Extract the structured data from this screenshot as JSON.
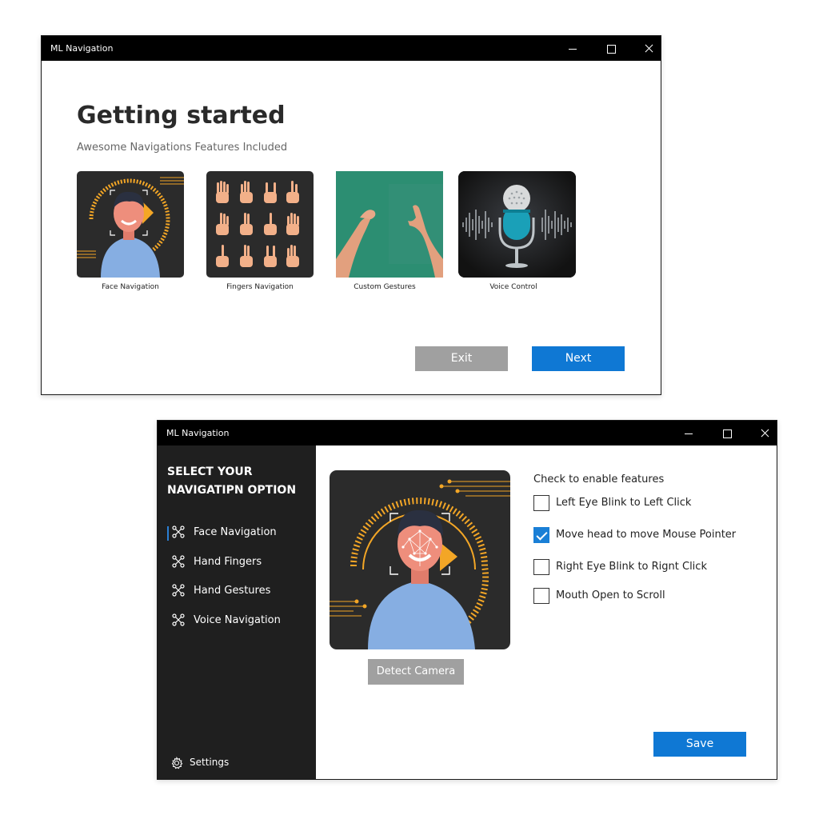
{
  "colors": {
    "accent": "#0f78d4",
    "disabled": "#a0a0a0",
    "sidebar": "#1f1f1f",
    "titlebar": "#000000",
    "illustration_bg": "#2b2b2b",
    "orange": "#f3a626"
  },
  "window1": {
    "title": "ML Navigation",
    "heading": "Getting started",
    "subheading": "Awesome Navigations Features Included",
    "cards": [
      {
        "label": "Face Navigation",
        "icon": "face-scan-illustration"
      },
      {
        "label": "Fingers Navigation",
        "icon": "hand-gestures-grid-illustration"
      },
      {
        "label": "Custom Gestures",
        "icon": "hands-photo"
      },
      {
        "label": "Voice Control",
        "icon": "microphone-illustration"
      }
    ],
    "exit_label": "Exit",
    "next_label": "Next"
  },
  "window2": {
    "title": "ML Navigation",
    "sidebar": {
      "title": "SELECT YOUR NAVIGATIPN OPTION",
      "items": [
        {
          "label": "Face Navigation",
          "icon": "nodes-icon",
          "active": true
        },
        {
          "label": "Hand Fingers",
          "icon": "nodes-icon",
          "active": false
        },
        {
          "label": "Hand Gestures",
          "icon": "nodes-icon",
          "active": false
        },
        {
          "label": "Voice Navigation",
          "icon": "nodes-icon",
          "active": false
        }
      ],
      "settings_label": "Settings"
    },
    "detect_camera_label": "Detect Camera",
    "features_title": "Check to enable features",
    "features": [
      {
        "label": "Left Eye Blink to Left Click",
        "checked": false
      },
      {
        "label": "Move head to move Mouse Pointer",
        "checked": true
      },
      {
        "label": "Right Eye Blink to Rignt Click",
        "checked": false
      },
      {
        "label": "Mouth Open to Scroll",
        "checked": false
      }
    ],
    "save_label": "Save"
  }
}
